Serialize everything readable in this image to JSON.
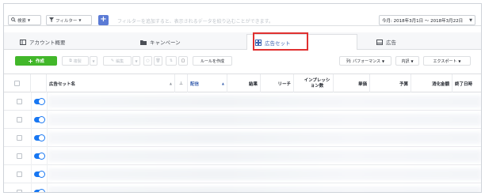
{
  "filterbar": {
    "search_label": "検索",
    "filter_label": "フィルター",
    "add_filter_label": "+",
    "hint": "フィルターを追加すると、表示されるデータを絞り込むことができます。",
    "date_range": "今月: 2018年3月1日 ～ 2018年3月22日"
  },
  "tabs": [
    {
      "label": "アカウント概要",
      "icon": "account-overview-icon"
    },
    {
      "label": "キャンペーン",
      "icon": "folder-icon"
    },
    {
      "label": "広告セット",
      "icon": "grid-icon",
      "active": true
    },
    {
      "label": "広告",
      "icon": "ad-icon"
    }
  ],
  "actionbar": {
    "create_label": "作成",
    "duplicate_label": "複製",
    "edit_label": "編集",
    "rules_label": "ルールを作成",
    "columns_label": "列: パフォーマンス",
    "breakdown_label": "内訳",
    "export_label": "エクスポート"
  },
  "table": {
    "columns": [
      "広告セット名",
      "配信",
      "結果",
      "リーチ",
      "インプレッション数",
      "単価",
      "予算",
      "消化金額",
      "終了日時"
    ],
    "row_count": 6
  },
  "colors": {
    "primary_blue": "#4267b2",
    "create_green": "#42b72a",
    "highlight_red": "#e03030"
  }
}
